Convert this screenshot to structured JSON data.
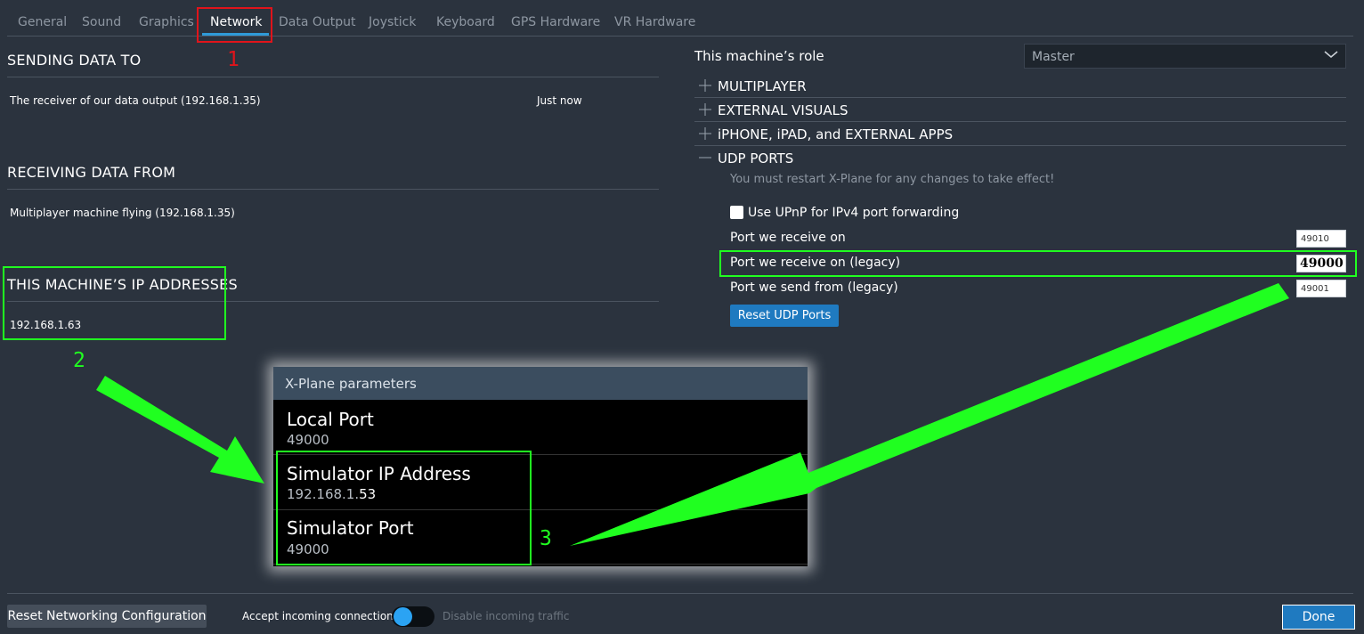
{
  "tabs": [
    {
      "label": "General"
    },
    {
      "label": "Sound"
    },
    {
      "label": "Graphics"
    },
    {
      "label": "Network",
      "active": true
    },
    {
      "label": "Data Output"
    },
    {
      "label": "Joystick"
    },
    {
      "label": "Keyboard"
    },
    {
      "label": "GPS Hardware"
    },
    {
      "label": "VR Hardware"
    }
  ],
  "annotations": {
    "num1": "1",
    "num2": "2",
    "num3": "3",
    "red_color": "#e0141b",
    "green_color": "#20ff20"
  },
  "sending": {
    "title": "SENDING DATA TO",
    "row_label": "The receiver of our data output (192.168.1.35)",
    "row_time": "Just now"
  },
  "receiving": {
    "title": "RECEIVING DATA FROM",
    "row_label": "Multiplayer machine flying  (192.168.1.35)"
  },
  "ip_addresses": {
    "title": "THIS MACHINE’S IP ADDRESSES",
    "value": "192.168.1.63"
  },
  "role": {
    "label": "This machine’s role",
    "selected": "Master"
  },
  "accordion": [
    {
      "label": "MULTIPLAYER",
      "icon": "plus-icon"
    },
    {
      "label": "EXTERNAL VISUALS",
      "icon": "plus-icon"
    },
    {
      "label": "iPHONE, iPAD, and EXTERNAL APPS",
      "icon": "plus-icon"
    },
    {
      "label": "UDP PORTS",
      "icon": "minus-icon"
    }
  ],
  "udp": {
    "note": "You must restart X-Plane for any changes to take effect!",
    "upnp_label": "Use UPnP for IPv4 port forwarding",
    "upnp_checked": false,
    "receive_label": "Port we receive on",
    "receive_value": "49010",
    "receive_legacy_label": "Port we receive on (legacy)",
    "receive_legacy_value": "49000",
    "send_legacy_label": "Port we send from (legacy)",
    "send_legacy_value": "49001",
    "reset_button": "Reset UDP Ports"
  },
  "inset": {
    "header": "X-Plane parameters",
    "items": [
      {
        "title": "Local Port",
        "value": "49000"
      },
      {
        "title": "Simulator IP Address",
        "value_prefix": "192.168.1.",
        "value_suffix": "53"
      },
      {
        "title": "Simulator Port",
        "value": "49000"
      }
    ]
  },
  "footer": {
    "reset_button": "Reset Networking Configuration",
    "toggle_left": "Accept incoming connections",
    "toggle_right": "Disable incoming traffic",
    "done_button": "Done"
  },
  "colors": {
    "background": "#2b333e",
    "accent_blue": "#1f7ac0",
    "tab_underline": "#2f9ad8"
  }
}
